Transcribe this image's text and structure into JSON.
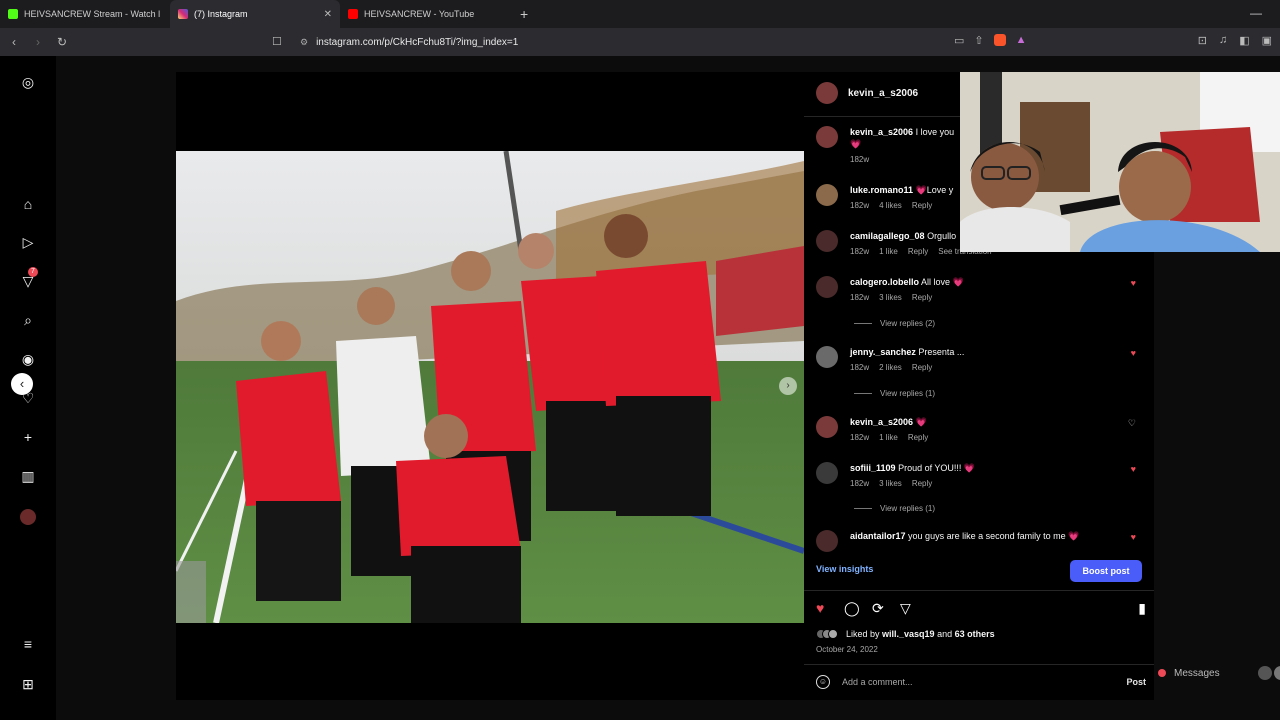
{
  "browser": {
    "tabs": [
      {
        "title": "HEIVSANCREW Stream - Watch l",
        "icon": "kick-icon",
        "color": "#53fc18"
      },
      {
        "title": "(7) Instagram",
        "icon": "instagram-icon",
        "color": "#e1306c",
        "active": true
      },
      {
        "title": "HEIVSANCREW - YouTube",
        "icon": "youtube-icon",
        "color": "#ff0000"
      }
    ],
    "url": "instagram.com/p/CkHcFchu8Ti/?img_index=1"
  },
  "rail": {
    "notifications_badge": "7"
  },
  "post": {
    "author": "kevin_a_s2006",
    "comments": [
      {
        "user": "kevin_a_s2006",
        "text": "I love you",
        "emoji": "💗",
        "time": "182w",
        "likes": "",
        "reply": "",
        "liked": false,
        "heart": false
      },
      {
        "user": "luke.romano11",
        "text": "💗Love y",
        "time": "182w",
        "likes": "4 likes",
        "reply": "Reply",
        "heart": false
      },
      {
        "user": "camilagallego_08",
        "text": "Orgullo",
        "time": "182w",
        "likes": "1 like",
        "reply": "Reply",
        "extra": "See translation",
        "heart": false
      },
      {
        "user": "calogero.lobello",
        "text": "All love 💗",
        "time": "182w",
        "likes": "3 likes",
        "reply": "Reply",
        "heart": true,
        "view_replies": "View replies (2)"
      },
      {
        "user": "jenny._sanchez",
        "text": "Presenta ...",
        "time": "182w",
        "likes": "2 likes",
        "reply": "Reply",
        "heart": true,
        "view_replies": "View replies (1)"
      },
      {
        "user": "kevin_a_s2006",
        "text": "💗",
        "time": "182w",
        "likes": "1 like",
        "reply": "Reply",
        "heart": "empty"
      },
      {
        "user": "sofiii_1109",
        "text": "Proud of YOU!!! 💗",
        "time": "182w",
        "likes": "3 likes",
        "reply": "Reply",
        "heart": true,
        "view_replies": "View replies (1)"
      },
      {
        "user": "aidantailor17",
        "text": "you guys are like a second family to me 💗",
        "heart": true
      }
    ],
    "view_insights": "View insights",
    "boost": "Boost post",
    "liked_by_prefix": "Liked by ",
    "liked_by_user": "will._vasq19",
    "liked_by_mid": " and ",
    "liked_by_others": "63 others",
    "date": "October 24, 2022",
    "add_comment_placeholder": "Add a comment...",
    "post_label": "Post"
  },
  "messages_label": "Messages"
}
